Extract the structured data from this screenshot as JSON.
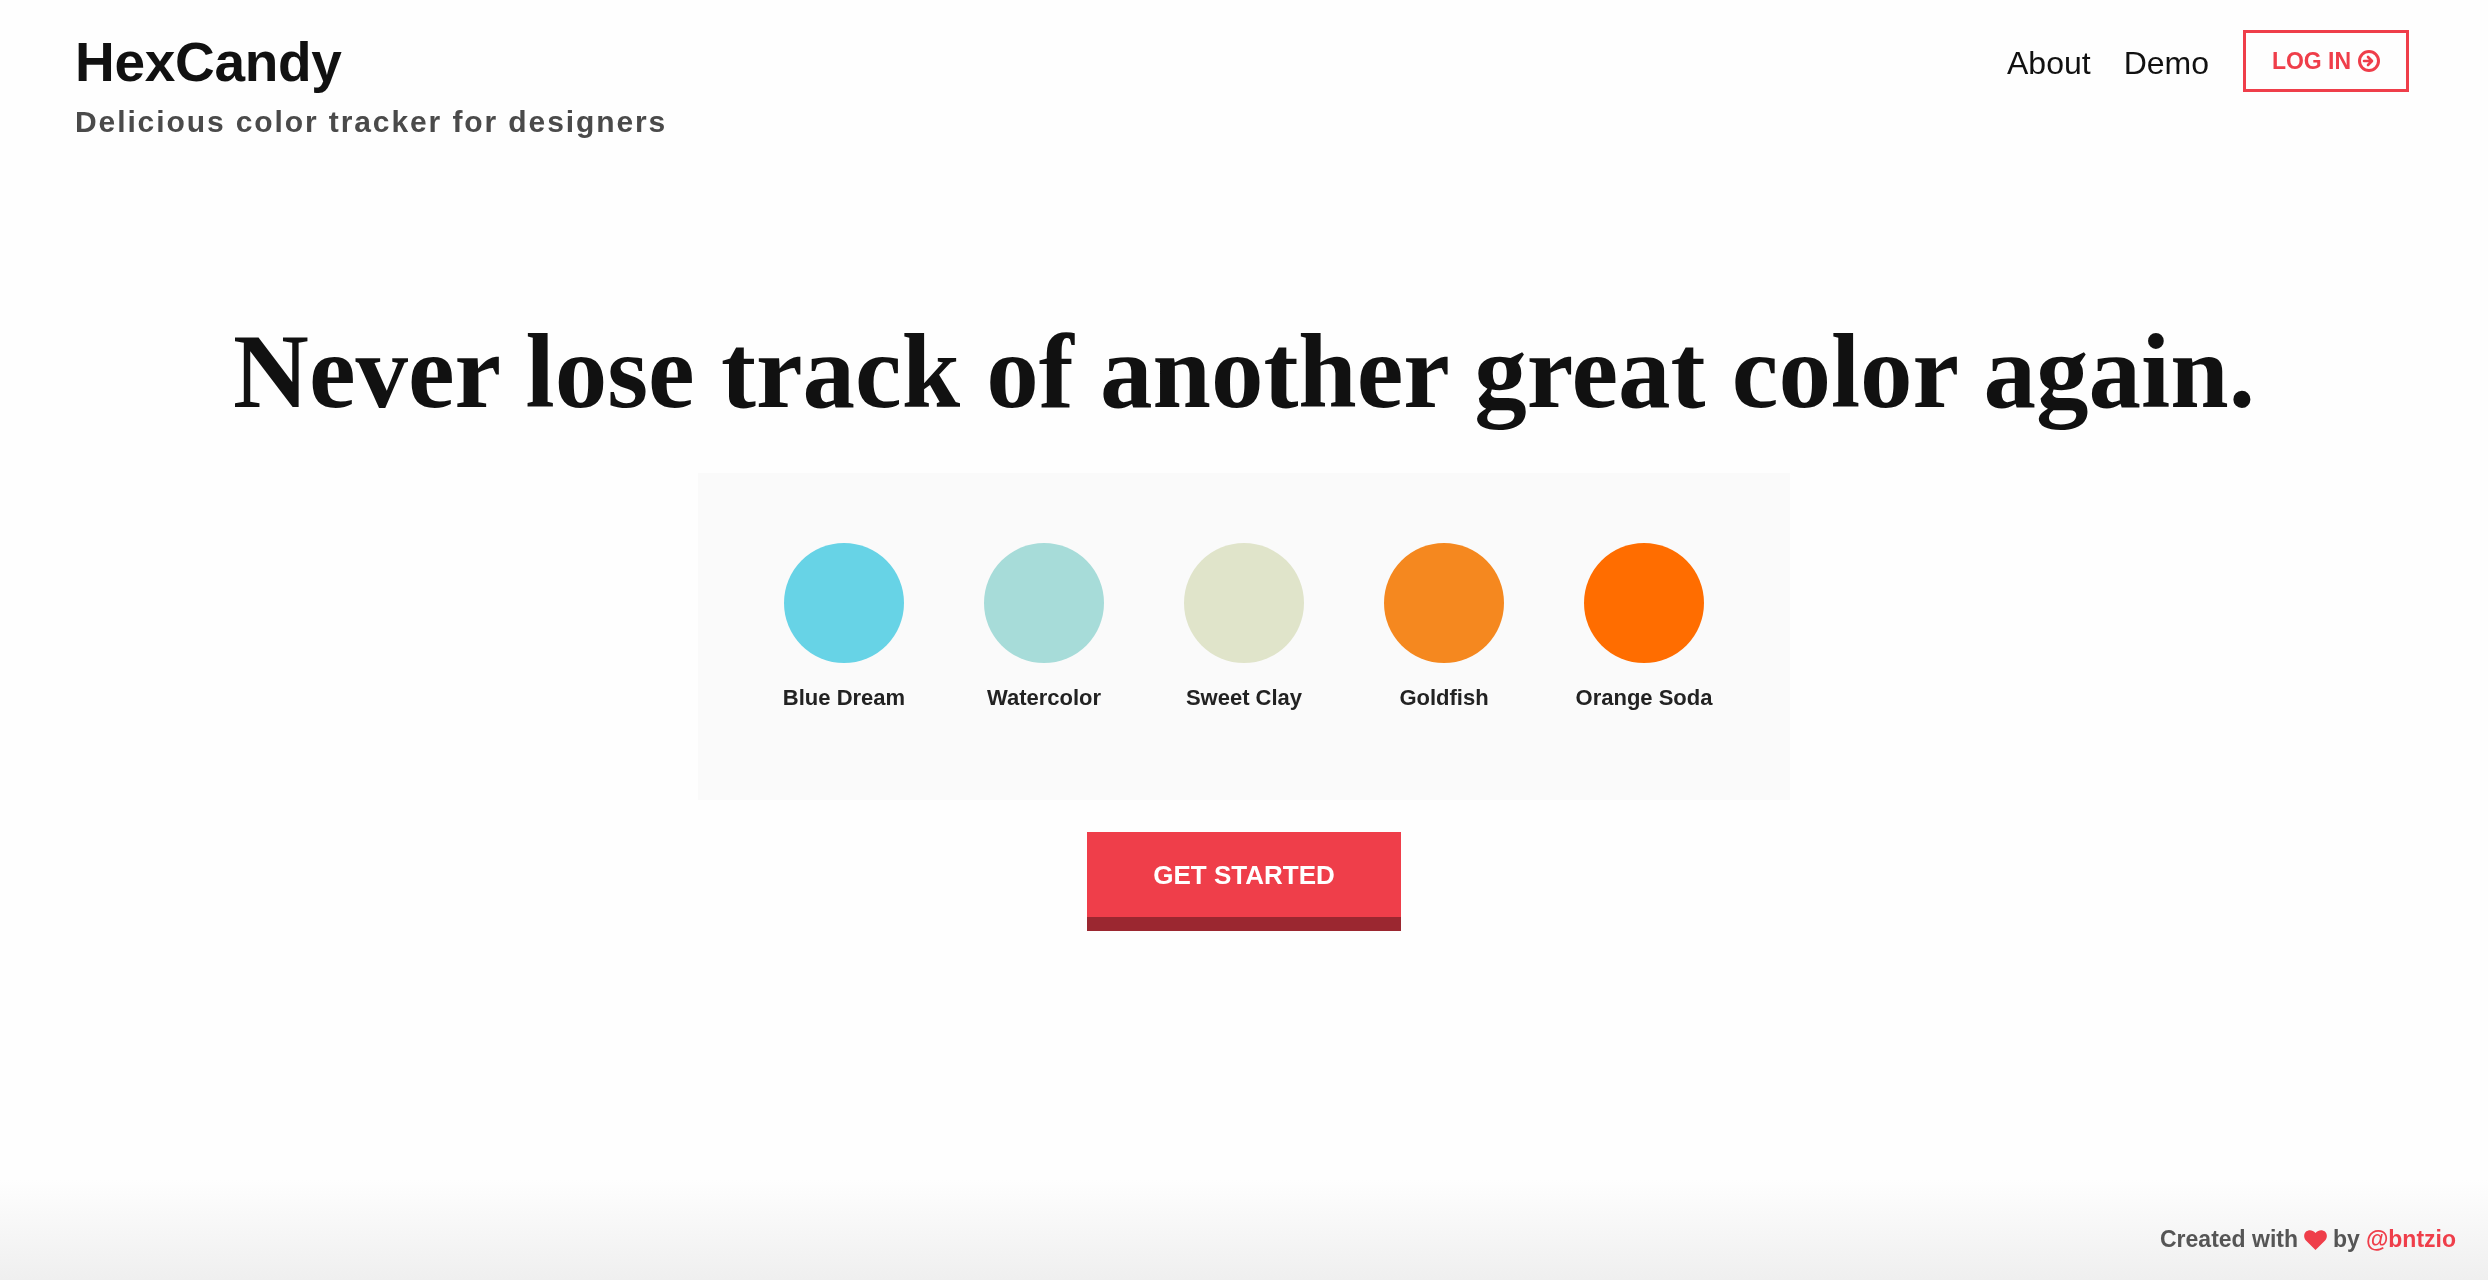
{
  "header": {
    "logo": "HexCandy",
    "tagline": "Delicious color tracker for designers"
  },
  "nav": {
    "links": [
      {
        "label": "About"
      },
      {
        "label": "Demo"
      }
    ],
    "login_button": "LOG IN"
  },
  "hero": {
    "headline": "Never lose track of another great color again.",
    "swatches": [
      {
        "name": "Blue Dream",
        "color": "#67d3e6"
      },
      {
        "name": "Watercolor",
        "color": "#a7dcd9"
      },
      {
        "name": "Sweet Clay",
        "color": "#e0e4ca"
      },
      {
        "name": "Goldfish",
        "color": "#f5881f"
      },
      {
        "name": "Orange Soda",
        "color": "#ff6d00"
      }
    ],
    "cta_button": "GET STARTED"
  },
  "footer": {
    "prefix": "Created with",
    "middle": "by",
    "link": "@bntzio"
  }
}
